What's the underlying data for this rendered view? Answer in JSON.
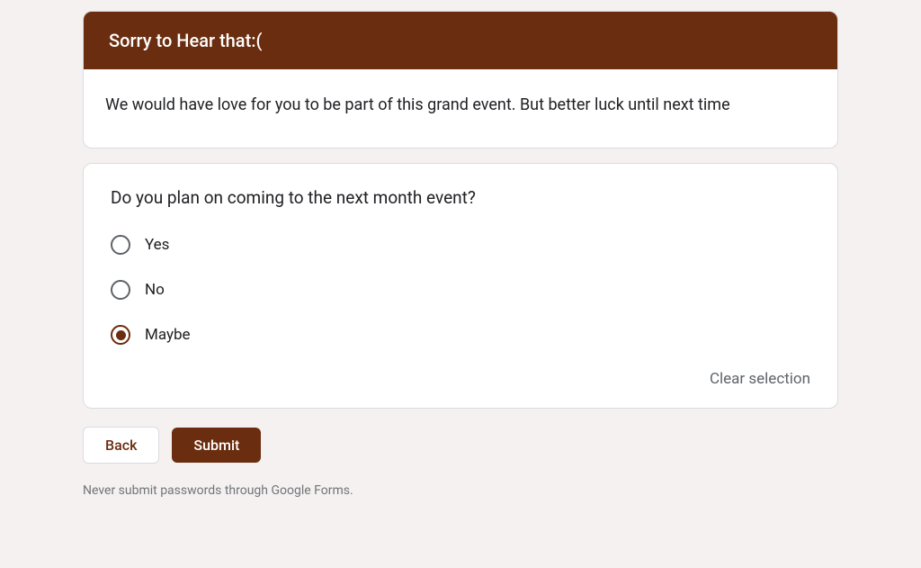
{
  "header": {
    "title": "Sorry to Hear that:(",
    "description": "We would have love for you to be part of this grand event. But better luck until next time"
  },
  "question": {
    "title": "Do you plan on coming to the next month event?",
    "options": [
      {
        "label": "Yes",
        "selected": false
      },
      {
        "label": "No",
        "selected": false
      },
      {
        "label": "Maybe",
        "selected": true
      }
    ],
    "clear_label": "Clear selection"
  },
  "buttons": {
    "back": "Back",
    "submit": "Submit"
  },
  "footer": {
    "warning": "Never submit passwords through Google Forms."
  },
  "colors": {
    "accent": "#6b2d0f"
  }
}
